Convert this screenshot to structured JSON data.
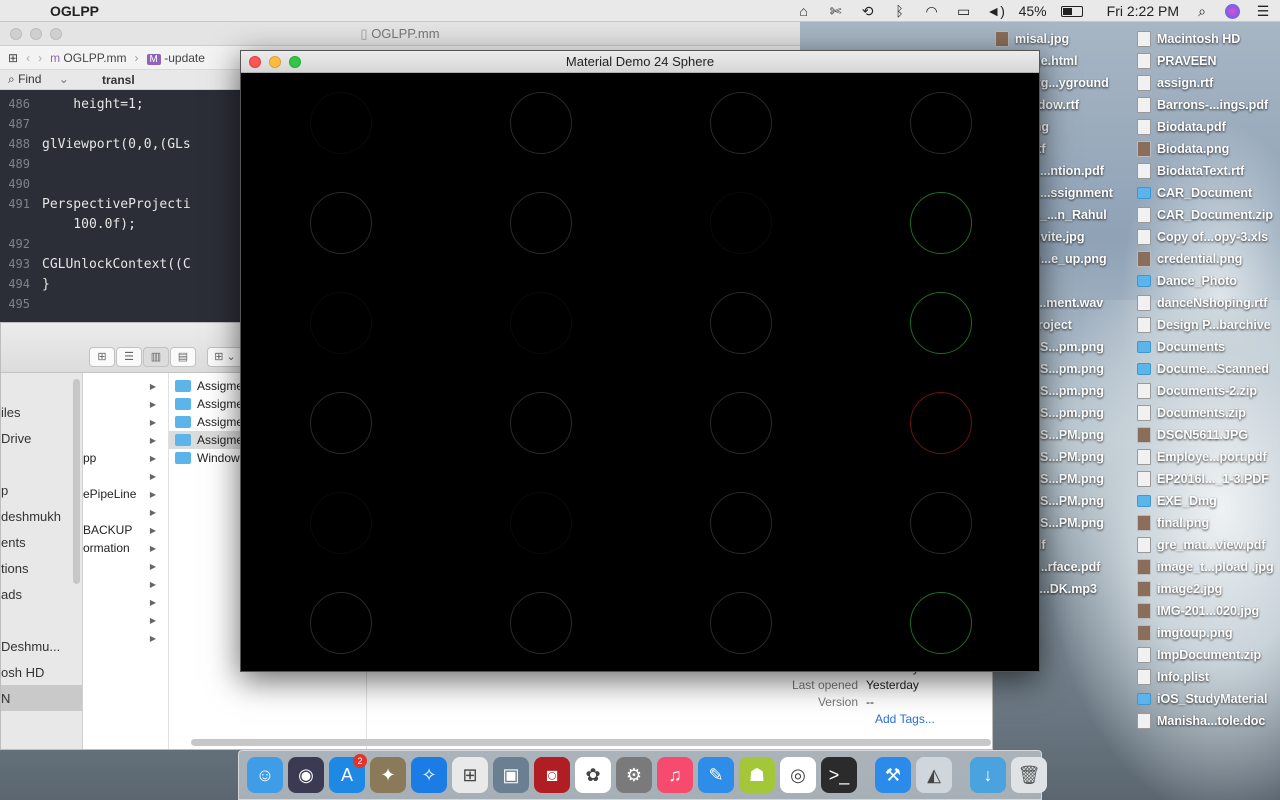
{
  "menubar": {
    "app_name": "OGLPP",
    "battery": "45%",
    "clock": "Fri 2:22 PM"
  },
  "xcode": {
    "title": "OGLPP.mm",
    "jump_file": "OGLPP.mm",
    "jump_method": "-update",
    "find_label": "Find",
    "find_query": "transl",
    "code": [
      {
        "ln": "486",
        "text": "    height=1;"
      },
      {
        "ln": "487",
        "text": ""
      },
      {
        "ln": "488",
        "text": "glViewport(0,0,(GLs"
      },
      {
        "ln": "489",
        "text": ""
      },
      {
        "ln": "490",
        "text": ""
      },
      {
        "ln": "491",
        "text": "PerspectiveProjecti"
      },
      {
        "ln": "",
        "text": "    100.0f);"
      },
      {
        "ln": "492",
        "text": ""
      },
      {
        "ln": "493",
        "text": "CGLUnlockContext((C"
      },
      {
        "ln": "494",
        "text": "}"
      },
      {
        "ln": "495",
        "text": ""
      }
    ]
  },
  "finder": {
    "sidebar": [
      "iles",
      "Drive",
      "",
      "p",
      "deshmukh",
      "ents",
      "tions",
      "ads",
      "",
      "Deshmu...",
      "osh HD",
      "N"
    ],
    "col2": [
      "",
      "",
      "",
      "",
      "pp",
      "",
      "ePipeLine",
      "",
      "BACKUP",
      "ormation",
      "",
      "",
      "",
      "",
      ""
    ],
    "col3": [
      "Assigme",
      "Assigme",
      "Assigme",
      "Assigme",
      "Window"
    ],
    "info": [
      {
        "k": "Modified",
        "v": "Yesterday"
      },
      {
        "k": "Last opened",
        "v": "Yesterday"
      },
      {
        "k": "Version",
        "v": "--"
      }
    ],
    "add_tags": "Add Tags..."
  },
  "gl_window": {
    "title": "Material Demo 24 Sphere"
  },
  "desktop": {
    "left_column": [
      {
        "name": "misal.jpg",
        "type": "img"
      },
      {
        "name": "mage.html",
        "type": "doc"
      },
      {
        "name": "Playg...yground",
        "type": "doc"
      },
      {
        "name": "Window.rtf",
        "type": "doc"
      },
      {
        "name": "n.png",
        "type": "img"
      },
      {
        "name": "ce.rtf",
        "type": "doc"
      },
      {
        "name": "nGL...ntion.pdf",
        "type": "doc"
      },
      {
        "name": "nGL...ssignment",
        "type": "doc"
      },
      {
        "name": "nGL_...n_Rahul",
        "type": "doc"
      },
      {
        "name": "o_invite.jpg",
        "type": "img"
      },
      {
        "name": "o_in...e_up.png",
        "type": "img"
      },
      {
        "name": "jpg",
        "type": "img"
      },
      {
        "name": "ess...ment.wav",
        "type": "doc"
      },
      {
        "name": "peProject",
        "type": "doc"
      },
      {
        "name": "een S...pm.png",
        "type": "img"
      },
      {
        "name": "een S...pm.png",
        "type": "img"
      },
      {
        "name": "een S...pm.png",
        "type": "img"
      },
      {
        "name": "een S...pm.png",
        "type": "img"
      },
      {
        "name": "een S...PM.png",
        "type": "img"
      },
      {
        "name": "een S...PM.png",
        "type": "img"
      },
      {
        "name": "een S...PM.png",
        "type": "img"
      },
      {
        "name": "een S...PM.png",
        "type": "img"
      },
      {
        "name": "een S...PM.png",
        "type": "img"
      },
      {
        "name": "t_pdf",
        "type": "folder"
      },
      {
        "name": "linu...rface.pdf",
        "type": "doc"
      },
      {
        "name": "e 06...DK.mp3",
        "type": "doc"
      }
    ],
    "right_column": [
      {
        "name": "Macintosh HD",
        "type": "doc"
      },
      {
        "name": "PRAVEEN",
        "type": "doc"
      },
      {
        "name": "assign.rtf",
        "type": "doc"
      },
      {
        "name": "Barrons-...ings.pdf",
        "type": "doc"
      },
      {
        "name": "Biodata.pdf",
        "type": "doc"
      },
      {
        "name": "Biodata.png",
        "type": "img"
      },
      {
        "name": "BiodataText.rtf",
        "type": "doc"
      },
      {
        "name": "CAR_Document",
        "type": "folder"
      },
      {
        "name": "CAR_Document.zip",
        "type": "doc"
      },
      {
        "name": "Copy of...opy-3.xls",
        "type": "doc"
      },
      {
        "name": "credential.png",
        "type": "img"
      },
      {
        "name": "Dance_Photo",
        "type": "folder"
      },
      {
        "name": "danceNshoping.rtf",
        "type": "doc"
      },
      {
        "name": "Design P...barchive",
        "type": "doc"
      },
      {
        "name": "Documents",
        "type": "folder"
      },
      {
        "name": "Docume...Scanned",
        "type": "folder"
      },
      {
        "name": "Documents-2.zip",
        "type": "doc"
      },
      {
        "name": "Documents.zip",
        "type": "doc"
      },
      {
        "name": "DSCN5611.JPG",
        "type": "img"
      },
      {
        "name": "Employe...port.pdf",
        "type": "doc"
      },
      {
        "name": "EP2016I..._1-3.PDF",
        "type": "doc"
      },
      {
        "name": "EXE_Dmg",
        "type": "folder"
      },
      {
        "name": "final.png",
        "type": "img"
      },
      {
        "name": "gre_mat...view.pdf",
        "type": "doc"
      },
      {
        "name": "image_t...pload .jpg",
        "type": "img"
      },
      {
        "name": "image2.jpg",
        "type": "img"
      },
      {
        "name": "IMG-201...020.jpg",
        "type": "img"
      },
      {
        "name": "imgtoup.png",
        "type": "img"
      },
      {
        "name": "ImpDocument.zip",
        "type": "doc"
      },
      {
        "name": "Info.plist",
        "type": "doc"
      },
      {
        "name": "iOS_StudyMaterial",
        "type": "folder"
      },
      {
        "name": "Manisha...tole.doc",
        "type": "doc"
      }
    ]
  },
  "dock": {
    "app_store_badge": "2",
    "apps": [
      "finder-icon",
      "siri-icon",
      "app-store-icon",
      "preview-bird-icon",
      "safari-icon",
      "launchpad-icon",
      "image-capture-icon",
      "photo-booth-icon",
      "photos-icon",
      "system-preferences-icon",
      "itunes-icon",
      "xcode-blueprint-icon",
      "android-studio-icon",
      "chrome-icon",
      "terminal-icon",
      "xcode-icon",
      "instruments-icon"
    ]
  },
  "colors": {
    "gl_background": "#000000",
    "sphere_green": "#1f6b1f",
    "sphere_red": "#6b1414",
    "sphere_dim": "#2a2a2a"
  }
}
